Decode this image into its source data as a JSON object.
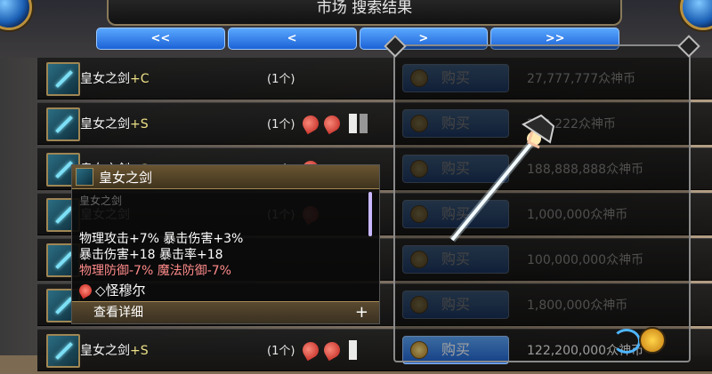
{
  "title": "市场 搜索结果",
  "pager": [
    {
      "label": "<<"
    },
    {
      "label": "<"
    },
    {
      "label": ">"
    },
    {
      "label": ">>"
    }
  ],
  "rows": [
    {
      "name": "皇女之剑",
      "plus": "+C",
      "qty": "(1个)",
      "buy": "购买",
      "price": "27,777,777众神币",
      "gems": 0,
      "slots": []
    },
    {
      "name": "皇女之剑",
      "plus": "+S",
      "qty": "(1个)",
      "buy": "购买",
      "price": "222,222众神币",
      "gems": 2,
      "slots": [
        "white",
        "gray"
      ]
    },
    {
      "name": "皇女之剑",
      "plus": "+S",
      "qty": "(1个)",
      "buy": "购买",
      "price": "188,888,888众神币",
      "gems": 1,
      "slots": []
    },
    {
      "name": "皇女之剑",
      "plus": "",
      "qty": "(1个)",
      "buy": "购买",
      "price": "1,000,000众神币",
      "gems": 1,
      "slots": []
    },
    {
      "name": "",
      "plus": "",
      "qty": "",
      "buy": "购买",
      "price": "100,000,000众神币",
      "gems": 0,
      "slots": []
    },
    {
      "name": "",
      "plus": "",
      "qty": "",
      "buy": "购买",
      "price": "1,800,000众神币",
      "gems": 0,
      "slots": []
    },
    {
      "name": "皇女之剑",
      "plus": "+S",
      "qty": "(1个)",
      "buy": "购买",
      "price": "122,200,000众神币",
      "gems": 2,
      "slots": [
        "white"
      ]
    }
  ],
  "tooltip": {
    "title": "皇女之剑",
    "faded": "皇女之剑",
    "lines": [
      {
        "text": "物理攻击+7% 暴击伤害+3%",
        "color": "white"
      },
      {
        "text": "暴击伤害+18 暴击率+18",
        "color": "white"
      },
      {
        "text": "物理防御-7% 魔法防御-7%",
        "color": "red"
      }
    ],
    "affix": "◇怪穆尔",
    "more": "查看详细",
    "more_plus": "+"
  }
}
